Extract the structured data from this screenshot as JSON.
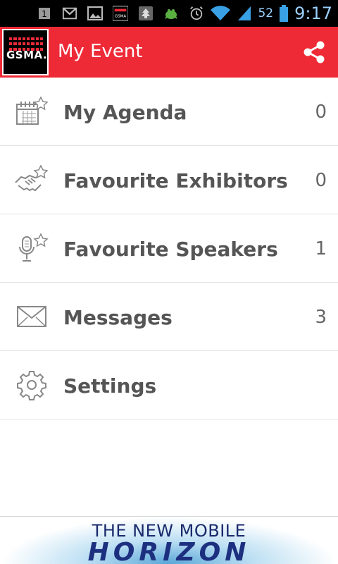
{
  "status_bar": {
    "notification_icons": [
      "sim-1-icon",
      "gmail-icon",
      "gallery-icon",
      "gsma-app-icon",
      "tree-icon",
      "android-bug-icon"
    ],
    "sim_badge": "1",
    "battery_percent": "52",
    "time": "9:17"
  },
  "app_bar": {
    "logo_text": "GSMA.",
    "title": "My Event",
    "accent_color": "#ee2a37"
  },
  "menu": {
    "items": [
      {
        "label": "My Agenda",
        "count": "0",
        "icon": "calendar-star-icon"
      },
      {
        "label": "Favourite Exhibitors",
        "count": "0",
        "icon": "handshake-star-icon"
      },
      {
        "label": "Favourite Speakers",
        "count": "1",
        "icon": "microphone-star-icon"
      },
      {
        "label": "Messages",
        "count": "3",
        "icon": "envelope-icon"
      },
      {
        "label": "Settings",
        "count": "",
        "icon": "gear-icon"
      }
    ]
  },
  "banner": {
    "line1": "THE NEW MOBILE",
    "line2": "HORIZON"
  }
}
